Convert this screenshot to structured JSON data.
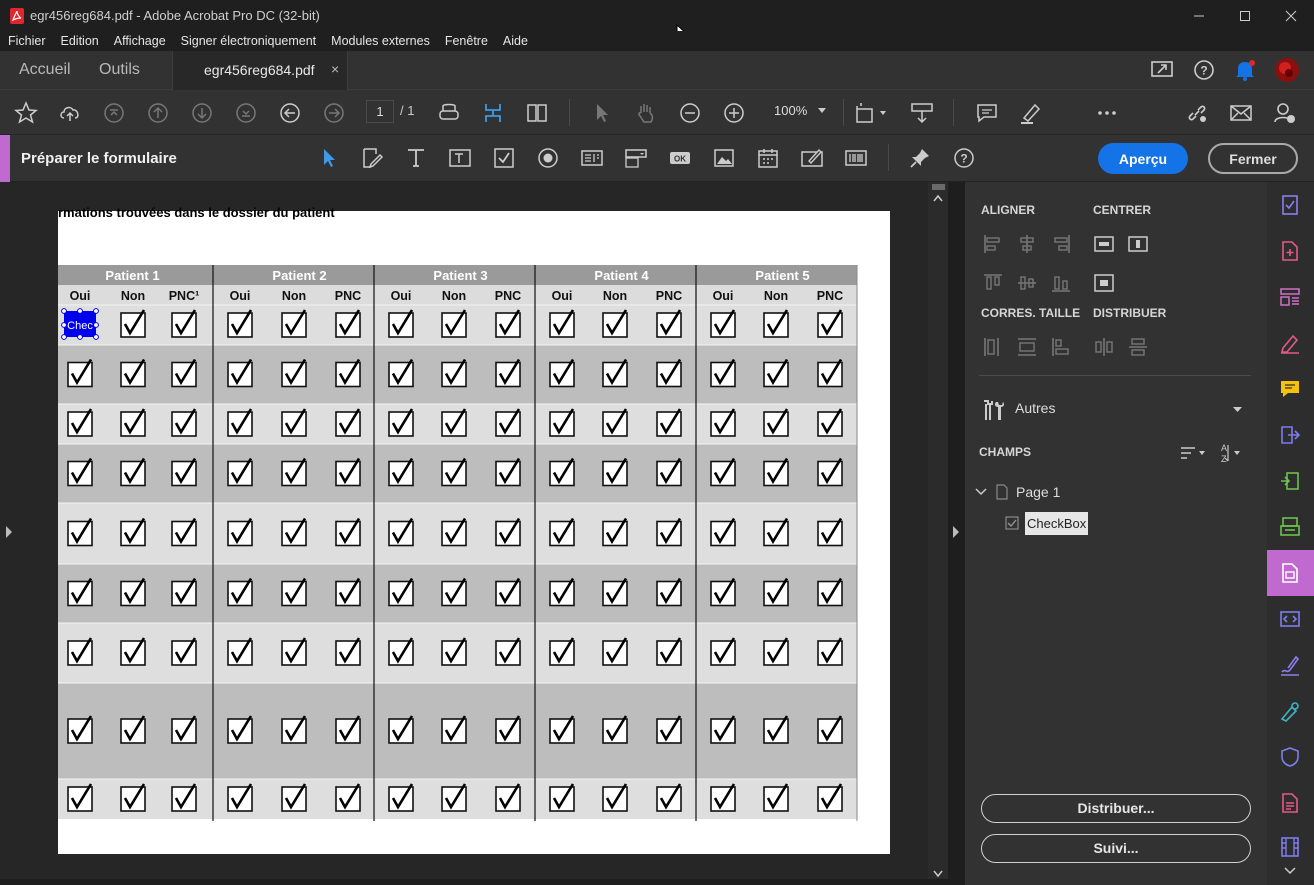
{
  "window": {
    "title": "egr456reg684.pdf - Adobe Acrobat Pro DC (32-bit)"
  },
  "menu": [
    "Fichier",
    "Edition",
    "Affichage",
    "Signer électroniquement",
    "Modules externes",
    "Fenêtre",
    "Aide"
  ],
  "tabs": {
    "home": "Accueil",
    "tools": "Outils",
    "document": "egr456reg684.pdf",
    "close": "×"
  },
  "toolbar": {
    "page_current": "1",
    "page_total": "/ 1",
    "zoom": "100%"
  },
  "form_bar": {
    "title": "Préparer le formulaire",
    "preview": "Aperçu",
    "close": "Fermer"
  },
  "document": {
    "heading": "rmations trouvées dans le dossier du patient",
    "patients": [
      "Patient 1",
      "Patient 2",
      "Patient 3",
      "Patient 4",
      "Patient 5"
    ],
    "subcols": [
      "Oui",
      "Non",
      "PNC¹",
      "Oui",
      "Non",
      "PNC",
      "Oui",
      "Non",
      "PNC",
      "Oui",
      "Non",
      "PNC",
      "Oui",
      "Non",
      "PNC"
    ],
    "selected_field_text": "Chec",
    "row_count": 9
  },
  "panel": {
    "align": "ALIGNER",
    "center": "CENTRER",
    "resize": "CORRES. TAILLE",
    "distribute_h": "DISTRIBUER",
    "others": "Autres",
    "fields": "CHAMPS",
    "page_node": "Page 1",
    "field_node": "CheckBox",
    "btn_distribute": "Distribuer...",
    "btn_track": "Suivi..."
  },
  "colors": {
    "accent": "#c06ad0",
    "primary": "#1473e6",
    "selection": "#0000ee"
  }
}
